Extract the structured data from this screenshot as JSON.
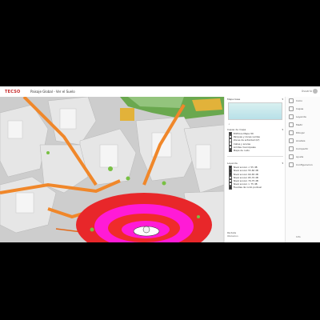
{
  "header": {
    "brand": "TECSO",
    "title": "Paisaje Global - Ver el Suelo",
    "user": "Usuario"
  },
  "panel": {
    "section1_title": "Mapa base",
    "section2_title": "Capas de mapa",
    "layers_top": [
      {
        "label": "Edificios Mapa 3D",
        "checked": true
      },
      {
        "label": "Parques y zonas verdes",
        "checked": false
      },
      {
        "label": "Zonas de actividad (LT)",
        "checked": false
      },
      {
        "label": "Calles y aceras",
        "checked": false
      },
      {
        "label": "Limites municipales",
        "checked": false
      },
      {
        "label": "Mapa de ruido",
        "checked": true
      }
    ],
    "section3_title": "Leyenda",
    "layers_bottom": [
      {
        "label": "Nivel sonoro < 55 dB",
        "checked": true
      },
      {
        "label": "Nivel sonoro 55-60 dB",
        "checked": true
      },
      {
        "label": "Nivel sonoro 60-65 dB",
        "checked": true
      },
      {
        "label": "Nivel sonoro 65-70 dB",
        "checked": false
      },
      {
        "label": "Nivel sonoro 70-75 dB",
        "checked": false
      },
      {
        "label": "Nivel sonoro > 75 dB",
        "checked": false
      },
      {
        "label": "Fuentes de ruido puntual",
        "checked": true
      }
    ],
    "footer": [
      "Pantalla",
      "Ubicacion"
    ]
  },
  "tools": [
    {
      "label": "Inicio",
      "icon": "home-icon"
    },
    {
      "label": "Capas",
      "icon": "layers-icon"
    },
    {
      "label": "Leyenda",
      "icon": "list-icon"
    },
    {
      "label": "Medir",
      "icon": "ruler-icon"
    },
    {
      "label": "Dibujar",
      "icon": "pencil-icon"
    },
    {
      "label": "Analisis",
      "icon": "chart-icon"
    },
    {
      "label": "Compartir",
      "icon": "share-icon"
    },
    {
      "label": "Ayuda",
      "icon": "help-icon"
    },
    {
      "label": "Configuracion",
      "icon": "gear-icon"
    }
  ],
  "tools_footer": "Info"
}
